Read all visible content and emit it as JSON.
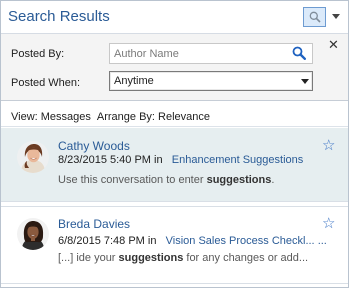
{
  "header": {
    "title": "Search Results",
    "search_icon": "search-icon",
    "menu_icon": "chevron-down-icon"
  },
  "form": {
    "close_label": "✕",
    "posted_by_label": "Posted By:",
    "author_placeholder": "Author Name",
    "author_value": "",
    "posted_when_label": "Posted When:",
    "posted_when_value": "Anytime"
  },
  "viewbar": {
    "view_label": "View: Messages",
    "arrange_label": "Arrange By: Relevance"
  },
  "results": [
    {
      "author": "Cathy Woods",
      "date": "8/23/2015 5:40 PM",
      "in_label": "in",
      "group": "Enhancement Suggestions",
      "snippet_pre": "Use this conversation to enter ",
      "snippet_bold": "suggestions",
      "snippet_post": ".",
      "star_icon": "star-outline-icon"
    },
    {
      "author": "Breda Davies",
      "date": "6/8/2015 7:48 PM",
      "in_label": "in",
      "group": "Vision Sales Process Checkl...",
      "group_more": "...",
      "snippet_pre": "[...] ide your ",
      "snippet_bold": "suggestions",
      "snippet_post": " for any changes or add...",
      "star_icon": "star-outline-icon"
    }
  ],
  "colors": {
    "accent": "#2a5b96",
    "selected_row": "#e6eef0",
    "star": "#3b73c5"
  }
}
